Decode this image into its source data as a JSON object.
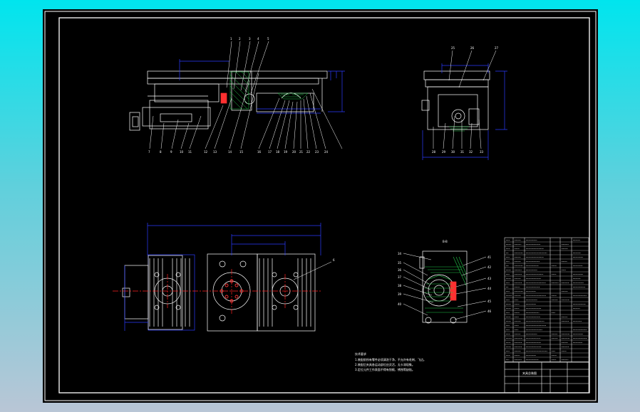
{
  "views": {
    "front_callouts_top": [
      "1",
      "2",
      "3",
      "4",
      "5"
    ],
    "front_callouts_bottom": [
      "7",
      "8",
      "9",
      "10",
      "11",
      "12",
      "13",
      "14",
      "15",
      "16",
      "17",
      "18",
      "19",
      "20",
      "21",
      "22",
      "23",
      "24"
    ],
    "side_callouts_top": [
      "25",
      "26",
      "27"
    ],
    "side_callouts_bottom": [
      "28",
      "29",
      "30",
      "31",
      "32",
      "33"
    ],
    "section_title": "B-B",
    "section_callouts_left": [
      "34",
      "35",
      "36",
      "37",
      "38",
      "39",
      "40"
    ],
    "section_callouts_right": [
      "41",
      "42",
      "43",
      "44",
      "45",
      "46"
    ],
    "plan_callout": "6"
  },
  "notes": {
    "heading": "技术要求",
    "lines": [
      "1.装配前所有零件必须清洗干净，不允许有毛刺、飞边。",
      "2.装配后夹具各运动部位应灵活，无卡滞现象。",
      "3.定位元件工作表面不得有划痕、锈蚀等缺陷。"
    ]
  },
  "title_block": {
    "drawing_name": "夹具总装图"
  },
  "colors": {
    "frame": "#ffffff",
    "dimension": "#2b3cff",
    "centerline": "#ff2020",
    "hatch": "#22c94a",
    "accent": "#ff3030"
  }
}
